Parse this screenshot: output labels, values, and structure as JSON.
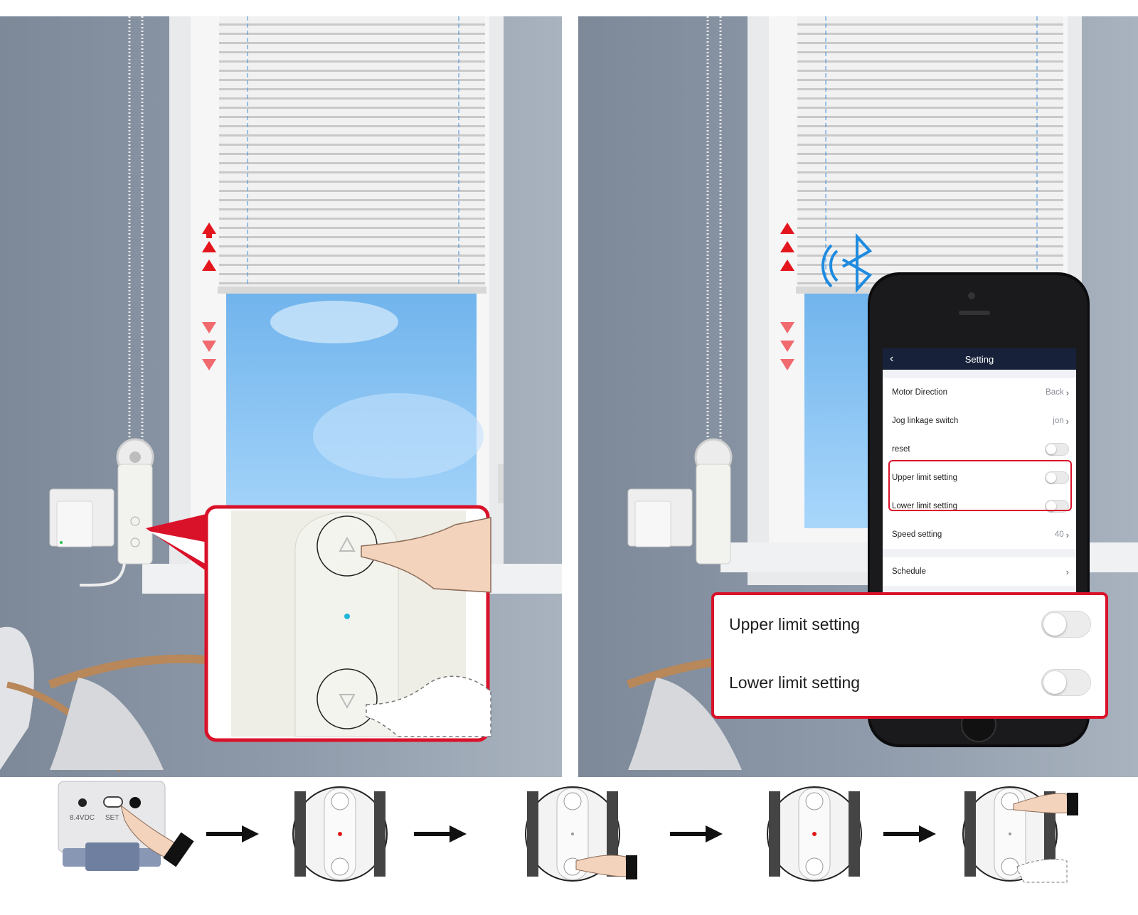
{
  "left_panel": {
    "controller": {
      "up_button_icon": "up-triangle-icon",
      "down_button_icon": "down-triangle-icon"
    }
  },
  "right_panel": {
    "app": {
      "header": {
        "back_icon": "chevron-left-icon",
        "title": "Setting"
      },
      "rows": [
        {
          "label": "Motor Direction",
          "value": "Back",
          "type": "link"
        },
        {
          "label": "Jog linkage switch",
          "value": "jon",
          "type": "link"
        },
        {
          "label": "reset",
          "type": "toggle",
          "on": false
        },
        {
          "label": "Upper limit setting",
          "type": "toggle",
          "on": false
        },
        {
          "label": "Lower limit setting",
          "type": "toggle",
          "on": false
        },
        {
          "label": "Speed setting",
          "value": "40",
          "type": "link"
        },
        {
          "label": "Schedule",
          "value": "",
          "type": "link"
        }
      ]
    },
    "zoom": {
      "rows": [
        {
          "label": "Upper limit setting",
          "on": false
        },
        {
          "label": "Lower limit setting",
          "on": false
        }
      ]
    },
    "bluetooth_icon": "bluetooth-icon"
  },
  "steps": {
    "motor_labels": {
      "voltage": "8.4VDC",
      "set": "SET"
    },
    "arrow_icon": "right-arrow-icon"
  },
  "colors": {
    "accent_red": "#d9122a",
    "header_navy": "#17223a",
    "wall": "#8c98a8",
    "sky": "#7fbff0"
  }
}
